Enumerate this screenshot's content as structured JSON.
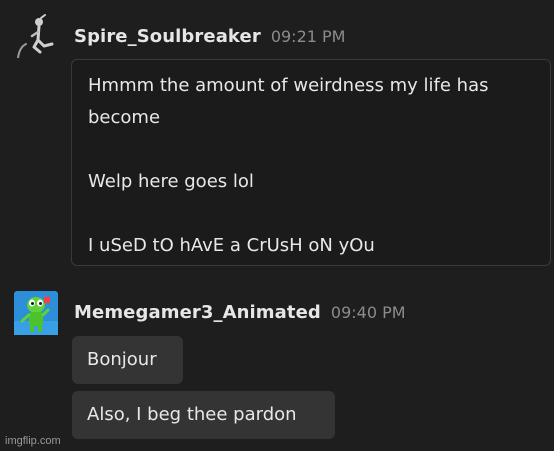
{
  "messages": [
    {
      "username": "Spire_Soulbreaker",
      "timestamp": "09:21 PM",
      "lines": [
        "Hmmm the amount of weirdness my life has become",
        "Welp here goes lol",
        "I uSeD tO hAvE a CrUsH oN yOu"
      ]
    },
    {
      "username": "Memegamer3_Animated",
      "timestamp": "09:40 PM",
      "bubbles": [
        "Bonjour",
        "Also, I beg thee pardon"
      ]
    }
  ],
  "watermark": "imgflip.com",
  "colors": {
    "background": "#1e1e1e",
    "bubble": "#343434",
    "username": "#e6e6e6",
    "timestamp": "#8b8b8b",
    "avatar2_bg": "#2c8fd8",
    "avatar2_figure": "#5fd23a"
  },
  "icons": {
    "avatar1": "stick-figure-icon",
    "avatar2": "green-character-icon"
  }
}
